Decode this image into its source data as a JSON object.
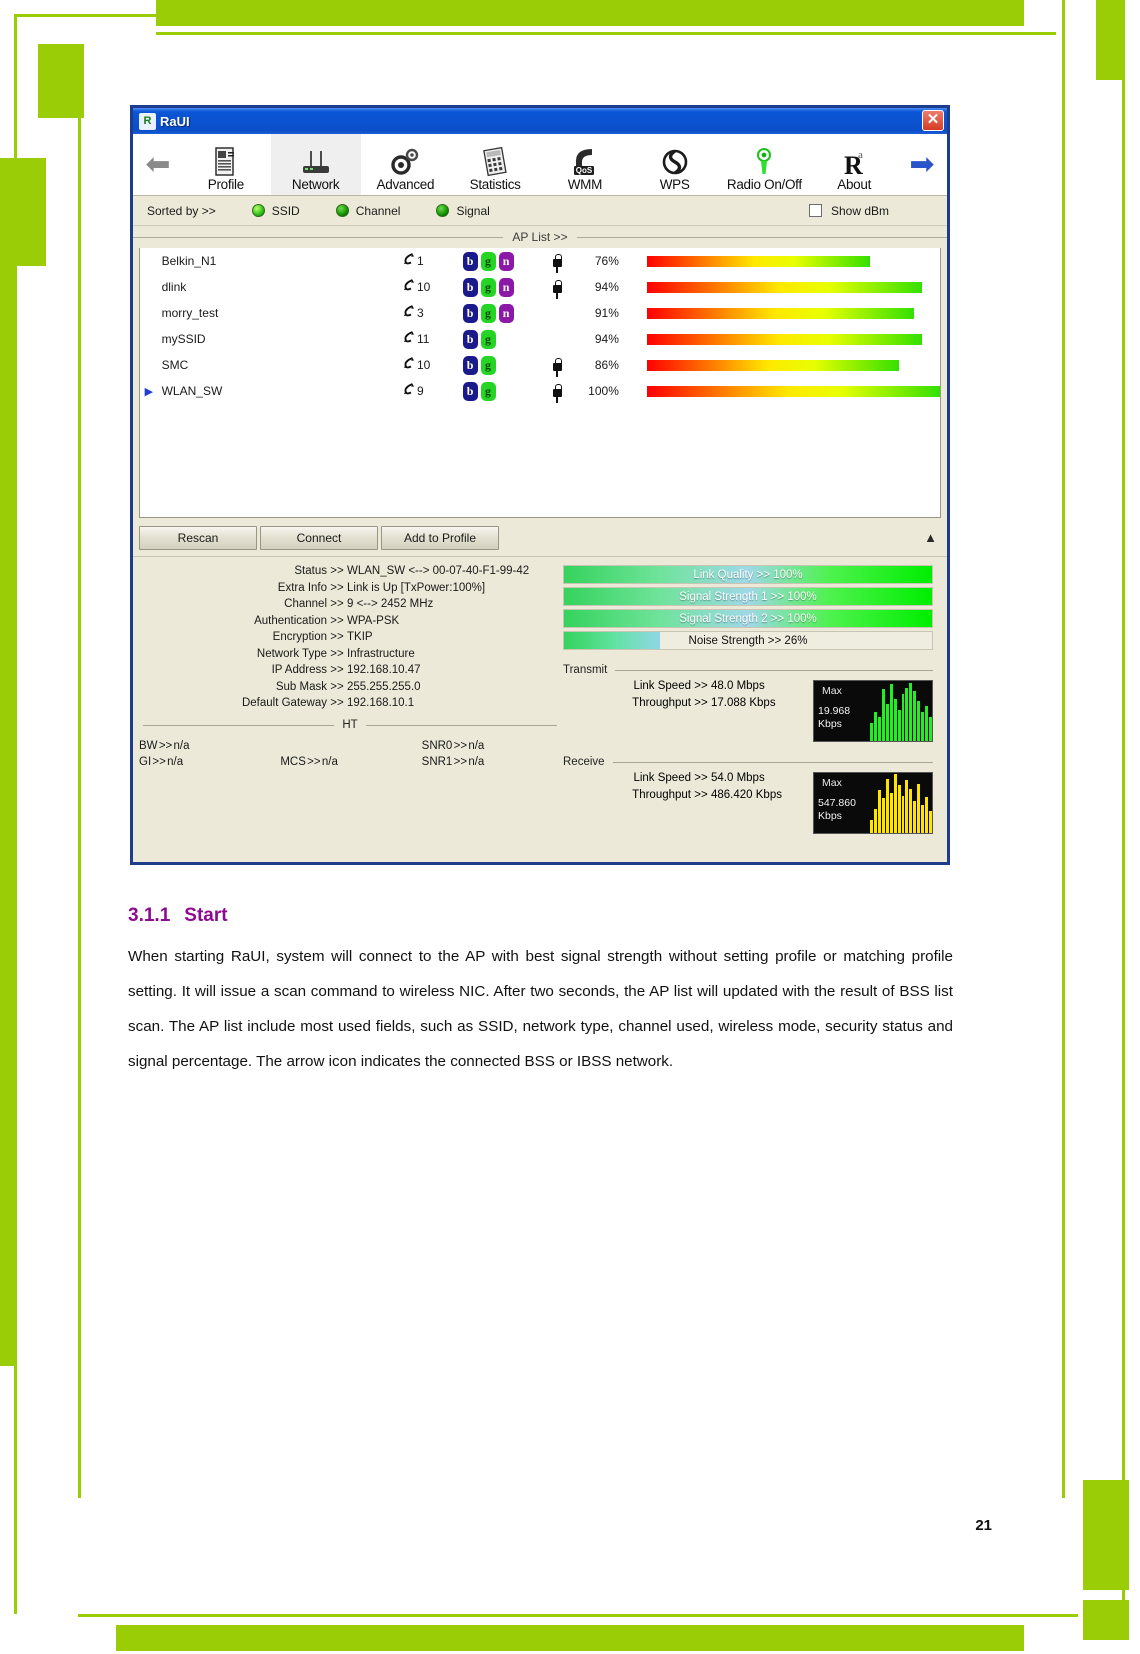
{
  "window": {
    "title": "RaUI",
    "app_icon": "raui-logo-icon",
    "close_label": "✕"
  },
  "toolbar": {
    "back_arrow": "⬅",
    "forward_arrow": "➡",
    "items": [
      {
        "label": "Profile",
        "icon": "profile-icon",
        "active": false
      },
      {
        "label": "Network",
        "icon": "network-icon",
        "active": true
      },
      {
        "label": "Advanced",
        "icon": "advanced-gear-icon",
        "active": false
      },
      {
        "label": "Statistics",
        "icon": "statistics-icon",
        "active": false
      },
      {
        "label": "WMM",
        "icon": "wmm-qos-icon",
        "active": false
      },
      {
        "label": "WPS",
        "icon": "wps-icon",
        "active": false
      },
      {
        "label": "Radio On/Off",
        "icon": "radio-onoff-icon",
        "active": false
      },
      {
        "label": "About",
        "icon": "about-r-icon",
        "active": false
      }
    ]
  },
  "sort_row": {
    "label": "Sorted by >>",
    "options": [
      {
        "label": "SSID",
        "selected": true
      },
      {
        "label": "Channel",
        "selected": false
      },
      {
        "label": "Signal",
        "selected": false
      }
    ],
    "show_dbm": {
      "label": "Show dBm",
      "checked": false
    }
  },
  "ap_list": {
    "title": "AP List >>",
    "rows": [
      {
        "connected": false,
        "ssid": "Belkin_N1",
        "channel": "1",
        "modes": [
          "b",
          "g",
          "n"
        ],
        "secured": true,
        "signal": "76%",
        "signal_value": 76
      },
      {
        "connected": false,
        "ssid": "dlink",
        "channel": "10",
        "modes": [
          "b",
          "g",
          "n"
        ],
        "secured": true,
        "signal": "94%",
        "signal_value": 94
      },
      {
        "connected": false,
        "ssid": "morry_test",
        "channel": "3",
        "modes": [
          "b",
          "g",
          "n"
        ],
        "secured": false,
        "signal": "91%",
        "signal_value": 91
      },
      {
        "connected": false,
        "ssid": "mySSID",
        "channel": "11",
        "modes": [
          "b",
          "g"
        ],
        "secured": false,
        "signal": "94%",
        "signal_value": 94
      },
      {
        "connected": false,
        "ssid": "SMC",
        "channel": "10",
        "modes": [
          "b",
          "g"
        ],
        "secured": true,
        "signal": "86%",
        "signal_value": 86
      },
      {
        "connected": true,
        "ssid": "WLAN_SW",
        "channel": "9",
        "modes": [
          "b",
          "g"
        ],
        "secured": true,
        "signal": "100%",
        "signal_value": 100
      }
    ]
  },
  "buttons": {
    "rescan": "Rescan",
    "connect": "Connect",
    "add_to_profile": "Add to Profile",
    "collapse_icon": "▲"
  },
  "status": {
    "separator": ">>",
    "rows": [
      {
        "key": "Status",
        "value": "WLAN_SW <--> 00-07-40-F1-99-42"
      },
      {
        "key": "Extra Info",
        "value": "Link is Up [TxPower:100%]"
      },
      {
        "key": "Channel",
        "value": "9 <--> 2452 MHz"
      },
      {
        "key": "Authentication",
        "value": "WPA-PSK"
      },
      {
        "key": "Encryption",
        "value": "TKIP"
      },
      {
        "key": "Network Type",
        "value": "Infrastructure"
      },
      {
        "key": "IP Address",
        "value": "192.168.10.47"
      },
      {
        "key": "Sub Mask",
        "value": "255.255.255.0"
      },
      {
        "key": "Default Gateway",
        "value": "192.168.10.1"
      }
    ],
    "ht_label": "HT",
    "ht": {
      "bw": {
        "key": "BW",
        "value": "n/a"
      },
      "gi": {
        "key": "GI",
        "value": "n/a"
      },
      "mcs": {
        "key": "MCS",
        "value": "n/a"
      },
      "snr0": {
        "key": "SNR0",
        "value": "n/a"
      },
      "snr1": {
        "key": "SNR1",
        "value": "n/a"
      }
    }
  },
  "quality": {
    "bars": [
      {
        "label": "Link Quality >> 100%",
        "percent": 100,
        "kind": "signal"
      },
      {
        "label": "Signal Strength 1 >> 100%",
        "percent": 100,
        "kind": "signal"
      },
      {
        "label": "Signal Strength 2 >> 100%",
        "percent": 100,
        "kind": "signal"
      },
      {
        "label": "Noise Strength >> 26%",
        "percent": 26,
        "kind": "noise"
      }
    ]
  },
  "transmit": {
    "title": "Transmit",
    "link_speed": {
      "key": "Link Speed",
      "value": "48.0 Mbps"
    },
    "throughput": {
      "key": "Throughput",
      "value": "17.088 Kbps"
    },
    "graph": {
      "max_label": "Max",
      "value": "19.968",
      "unit": "Kbps",
      "color": "#22ee22"
    }
  },
  "receive": {
    "title": "Receive",
    "link_speed": {
      "key": "Link Speed",
      "value": "54.0 Mbps"
    },
    "throughput": {
      "key": "Throughput",
      "value": "486.420 Kbps"
    },
    "graph": {
      "max_label": "Max",
      "value": "547.860",
      "unit": "Kbps",
      "color": "#ffe400"
    }
  },
  "document": {
    "heading_number": "3.1.1",
    "heading_title": "Start",
    "body": "When starting RaUI, system will connect to the AP with best signal strength without setting profile or matching profile setting. It will issue a scan command to wireless NIC. After two seconds, the AP list will updated with the result of BSS list scan. The AP list include most used fields, such as SSID, network type, channel used, wireless mode, security status and signal percentage. The arrow icon indicates the connected BSS or IBSS network.",
    "page_number": "21"
  },
  "colors": {
    "frame_green": "#9ACD06",
    "heading_purple": "#8E0A8E",
    "title_bar_blue": "#0A56D6",
    "mode_b": "#1A1A8C",
    "mode_g": "#25D425",
    "mode_n": "#8C18A8"
  }
}
